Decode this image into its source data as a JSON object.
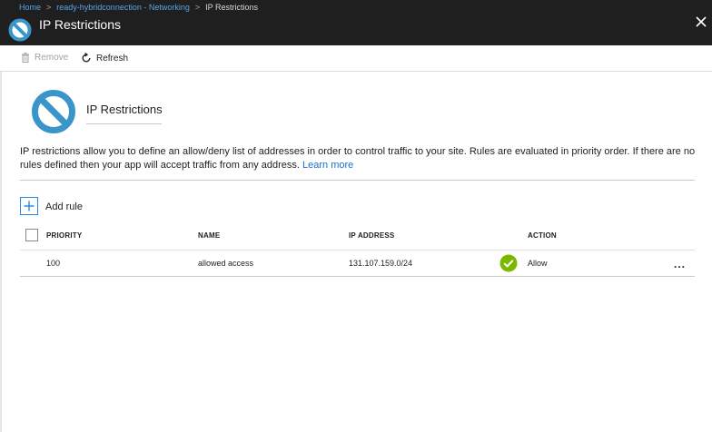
{
  "breadcrumb": {
    "home": "Home",
    "parent": "ready-hybridconnection - Networking",
    "current": "IP Restrictions",
    "separator": ">"
  },
  "blade": {
    "title": "IP Restrictions",
    "icon": "no-entry-icon",
    "close_icon": "close-icon"
  },
  "toolbar": {
    "remove_label": "Remove",
    "refresh_label": "Refresh"
  },
  "content": {
    "title": "IP Restrictions",
    "description": "IP restrictions allow you to define an allow/deny list of addresses in order to control traffic to your site. Rules are evaluated in priority order. If there are no rules defined then your app will accept traffic from any address. ",
    "learn_more": "Learn more"
  },
  "add_rule": {
    "label": "Add rule"
  },
  "table": {
    "columns": {
      "priority": "PRIORITY",
      "name": "NAME",
      "ip_address": "IP ADDRESS",
      "action": "ACTION"
    },
    "rows": [
      {
        "priority": "100",
        "name": "allowed access",
        "ip_address": "131.107.159.0/24",
        "action": "Allow",
        "status_icon": "check-circle-icon",
        "more": "..."
      }
    ]
  },
  "colors": {
    "header_bg": "#1f1f1f",
    "accent_blue": "#2b88d8",
    "icon_blue": "#3a96c9",
    "success_green": "#7ab800",
    "link_blue": "#1a6fd0"
  }
}
